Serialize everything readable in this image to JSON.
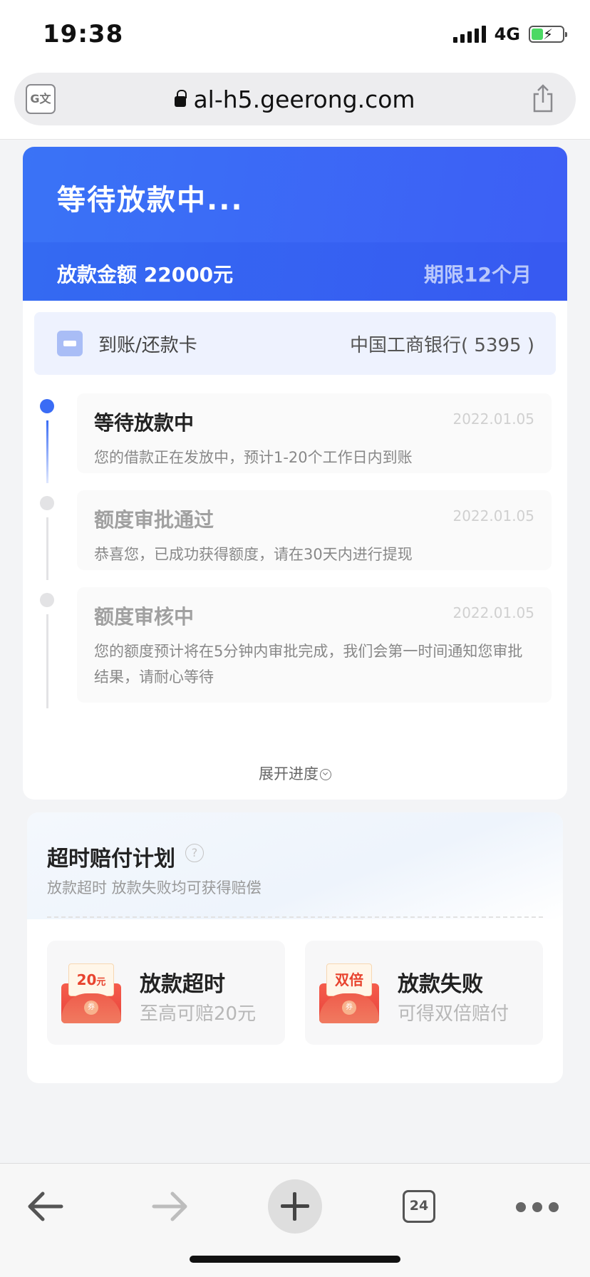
{
  "status_bar": {
    "time": "19:38",
    "network": "4G"
  },
  "browser": {
    "url": "al-h5.geerong.com",
    "tab_count": "24"
  },
  "hero": {
    "title": "等待放款中...",
    "amount": "放款金额 22000元",
    "term": "期限12个月"
  },
  "card_row": {
    "label": "到账/还款卡",
    "bank": "中国工商银行( 5395 )"
  },
  "timeline": [
    {
      "title": "等待放款中",
      "date": "2022.01.05",
      "desc": "您的借款正在发放中，预计1-20个工作日内到账",
      "active": true
    },
    {
      "title": "额度审批通过",
      "date": "2022.01.05",
      "desc": "恭喜您，已成功获得额度，请在30天内进行提现",
      "active": false
    },
    {
      "title": "额度审核中",
      "date": "2022.01.05",
      "desc": "您的额度预计将在5分钟内审批完成，我们会第一时间通知您审批结果，请耐心等待",
      "active": false
    }
  ],
  "expand_label": "展开进度",
  "compensation": {
    "title": "超时赔付计划",
    "subtitle": "放款超时 放款失败均可获得赔偿",
    "items": [
      {
        "badge": "20",
        "badge_unit": "元",
        "title": "放款超时",
        "desc": "至高可赔20元"
      },
      {
        "badge": "双倍",
        "badge_unit": "",
        "title": "放款失败",
        "desc": "可得双倍赔付"
      }
    ],
    "coin_label": "券"
  },
  "colors": {
    "accent": "#3a6cf5",
    "hero_start": "#3a73f6",
    "hero_end": "#3d5ef5",
    "envelope_red": "#e8433b"
  }
}
